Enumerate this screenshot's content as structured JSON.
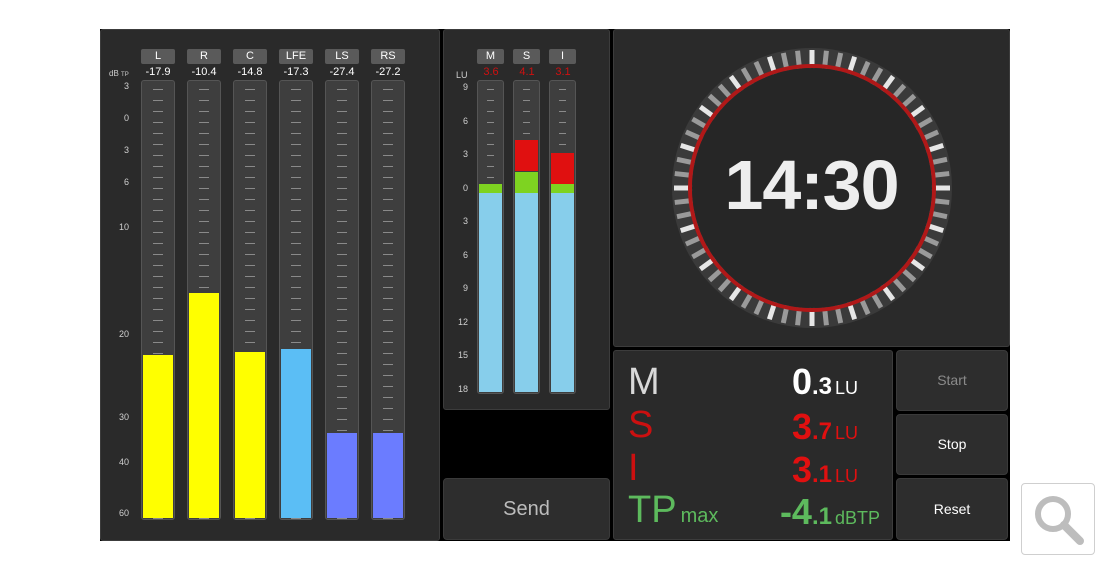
{
  "channels": {
    "unit": "dB",
    "unit_sub": "TP",
    "scale": [
      "3",
      "0",
      "3",
      "6",
      "10",
      "20",
      "30",
      "40",
      "60"
    ],
    "items": [
      {
        "label": "L",
        "value": "-17.9",
        "level": 0.373,
        "color": "#ffff00"
      },
      {
        "label": "R",
        "value": "-10.4",
        "level": 0.513,
        "color": "#ffff00"
      },
      {
        "label": "C",
        "value": "-14.8",
        "level": 0.38,
        "color": "#ffff00"
      },
      {
        "label": "LFE",
        "value": "-17.3",
        "level": 0.385,
        "color": "#5bbef5"
      },
      {
        "label": "LS",
        "value": "-27.4",
        "level": 0.195,
        "color": "#6b7cff"
      },
      {
        "label": "RS",
        "value": "-27.2",
        "level": 0.195,
        "color": "#6b7cff"
      }
    ]
  },
  "loudness": {
    "unit": "LU",
    "scale": [
      "9",
      "6",
      "3",
      "0",
      "3",
      "6",
      "9",
      "12",
      "15",
      "18"
    ],
    "items": [
      {
        "label": "M",
        "value": "3.6",
        "level_blue": 0.64,
        "level_green": 0.03,
        "level_red": 0.0
      },
      {
        "label": "S",
        "value": "4.1",
        "level_blue": 0.64,
        "level_green": 0.07,
        "level_red": 0.1
      },
      {
        "label": "I",
        "value": "3.1",
        "level_blue": 0.64,
        "level_green": 0.03,
        "level_red": 0.1
      }
    ]
  },
  "send_label": "Send",
  "timer": {
    "time": "14:30"
  },
  "readout": {
    "m": {
      "label": "M",
      "int": "0",
      "dec": ".3",
      "unit": "LU",
      "color": "#ffffff",
      "label_color": "#d8d8d8"
    },
    "s": {
      "label": "S",
      "int": "3",
      "dec": ".7",
      "unit": "LU",
      "color": "#e01010",
      "label_color": "#cc1010"
    },
    "i": {
      "label": "I",
      "int": "3",
      "dec": ".1",
      "unit": "LU",
      "color": "#e01010",
      "label_color": "#cc1010"
    },
    "tp": {
      "label": "TP",
      "label_sub": "max",
      "int": "-4",
      "dec": ".1",
      "unit": "dBTP",
      "color": "#5dba5d",
      "label_color": "#5dba5d"
    }
  },
  "buttons": {
    "start": "Start",
    "stop": "Stop",
    "reset": "Reset"
  },
  "zoom_icon": "magnifier-icon"
}
